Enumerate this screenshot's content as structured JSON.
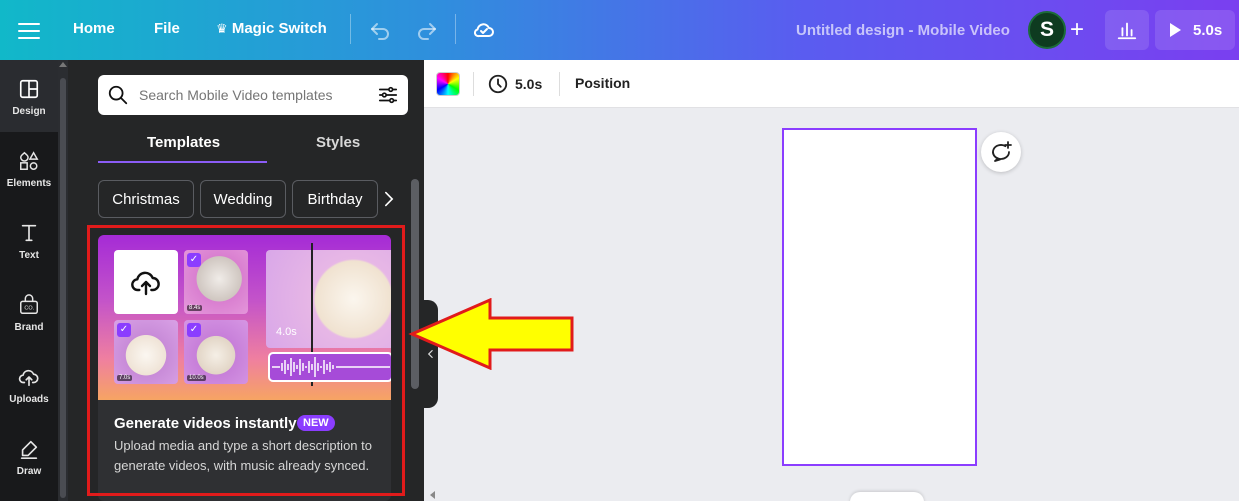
{
  "topbar": {
    "home_label": "Home",
    "file_label": "File",
    "magic_label": "Magic Switch",
    "design_title": "Untitled design - Mobile Video",
    "avatar_initial": "S",
    "plus_symbol": "+",
    "play_duration": "5.0s"
  },
  "rail": {
    "items": [
      {
        "label": "Design",
        "icon": "design-icon"
      },
      {
        "label": "Elements",
        "icon": "elements-icon"
      },
      {
        "label": "Text",
        "icon": "text-icon"
      },
      {
        "label": "Brand",
        "icon": "brand-icon"
      },
      {
        "label": "Uploads",
        "icon": "uploads-icon"
      },
      {
        "label": "Draw",
        "icon": "draw-icon"
      }
    ]
  },
  "panel": {
    "search_placeholder": "Search Mobile Video templates",
    "tabs": [
      {
        "label": "Templates",
        "active": true
      },
      {
        "label": "Styles",
        "active": false
      }
    ],
    "chips": [
      "Christmas",
      "Wedding",
      "Birthday"
    ],
    "card": {
      "title": "Generate videos instantly",
      "badge": "NEW",
      "description": "Upload media and type a short description to generate videos, with music already synced.",
      "thumb_durations": [
        "8.4s",
        "7.0s",
        "10.0s"
      ],
      "preview_duration": "4.0s"
    }
  },
  "canvas_toolbar": {
    "duration": "5.0s",
    "position_label": "Position"
  },
  "colors": {
    "accent": "#8b3dff",
    "highlight": "#e11b1b",
    "arrow_fill": "#ffff00"
  }
}
